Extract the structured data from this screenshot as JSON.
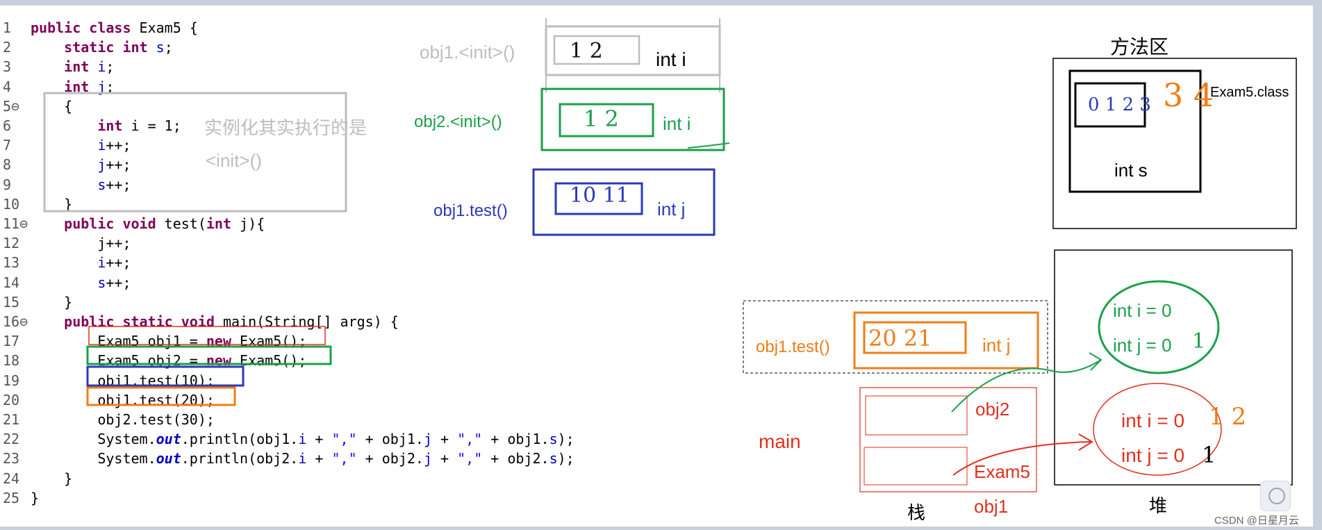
{
  "code": {
    "lines": [
      {
        "n": "1",
        "html": "<span class=\"kw\">public class</span> Exam5 {"
      },
      {
        "n": "2",
        "html": "    <span class=\"kw\">static int</span> <span class=\"fld\">s</span>;"
      },
      {
        "n": "3",
        "html": "    <span class=\"kw\">int</span> <span class=\"fld\">i</span>;"
      },
      {
        "n": "4",
        "html": "    <span class=\"kw\">int</span> <span class=\"fld\">j</span>;"
      },
      {
        "n": "5",
        "html": "    {"
      },
      {
        "n": "6",
        "html": "        <span class=\"kw\">int</span> i = 1;"
      },
      {
        "n": "7",
        "html": "        <span class=\"fld\">i</span>++;"
      },
      {
        "n": "8",
        "html": "        <span class=\"fld\">j</span>++;"
      },
      {
        "n": "9",
        "html": "        <span class=\"fld\">s</span>++;"
      },
      {
        "n": "10",
        "html": "    }"
      },
      {
        "n": "11",
        "html": "    <span class=\"kw\">public void</span> test(<span class=\"kw\">int</span> j){"
      },
      {
        "n": "12",
        "html": "        j++;"
      },
      {
        "n": "13",
        "html": "        <span class=\"fld\">i</span>++;"
      },
      {
        "n": "14",
        "html": "        <span class=\"fld\">s</span>++;"
      },
      {
        "n": "15",
        "html": "    }"
      },
      {
        "n": "16",
        "html": "    <span class=\"kw\">public static void</span> main(String[] args) {"
      },
      {
        "n": "17",
        "html": "        Exam5 obj1 = <span class=\"kw\">new</span> Exam5();"
      },
      {
        "n": "18",
        "html": "        Exam5 obj2 = <span class=\"kw\">new</span> Exam5();"
      },
      {
        "n": "19",
        "html": "        obj1.test(10);"
      },
      {
        "n": "20",
        "html": "        obj1.test(20);"
      },
      {
        "n": "21",
        "html": "        obj2.test(30);"
      },
      {
        "n": "22",
        "html": "        System.<span class=\"stat\">out</span>.println(obj1.<span class=\"fld\">i</span> + <span class=\"str\">\",\"</span> + obj1.<span class=\"fld\">j</span> + <span class=\"str\">\",\"</span> + obj1.<span class=\"fld\">s</span>);"
      },
      {
        "n": "23",
        "html": "        System.<span class=\"stat\">out</span>.println(obj2.<span class=\"fld\">i</span> + <span class=\"str\">\",\"</span> + obj2.<span class=\"fld\">j</span> + <span class=\"str\">\",\"</span> + obj2.<span class=\"fld\">s</span>);"
      },
      {
        "n": "24",
        "html": "    }"
      },
      {
        "n": "25",
        "html": "}"
      }
    ],
    "fold_lines": [
      "5",
      "11",
      "16"
    ]
  },
  "annotations": {
    "init_note_line1": "实例化其实执行的是",
    "init_note_line2": "<init>()",
    "frame1_label": "obj1.<init>()",
    "frame1_var": "int i",
    "frame2_label": "obj2.<init>()",
    "frame2_var": "int i",
    "frame3_label": "obj1.test()",
    "frame3_var": "int j",
    "frame4_label": "obj1.test()",
    "frame4_var": "int j",
    "method_area_title": "方法区",
    "class_name": "Exam5.class",
    "static_var": "int s",
    "main_label": "main",
    "stack_obj2": "obj2",
    "stack_exam5": "Exam5",
    "stack_obj1": "obj1",
    "stack_title": "栈",
    "heap_title": "堆",
    "heap_obj2_i": "int i = 0",
    "heap_obj2_j": "int j = 0",
    "heap_obj1_i": "int i = 0",
    "heap_obj1_j": "int j = 0",
    "watermark": "CSDN @日星月云"
  },
  "colors": {
    "gray": "#bdbdbd",
    "green": "#1aa04a",
    "blue": "#2b39b8",
    "orange": "#f07d16",
    "red": "#e0301e",
    "black": "#000000"
  }
}
